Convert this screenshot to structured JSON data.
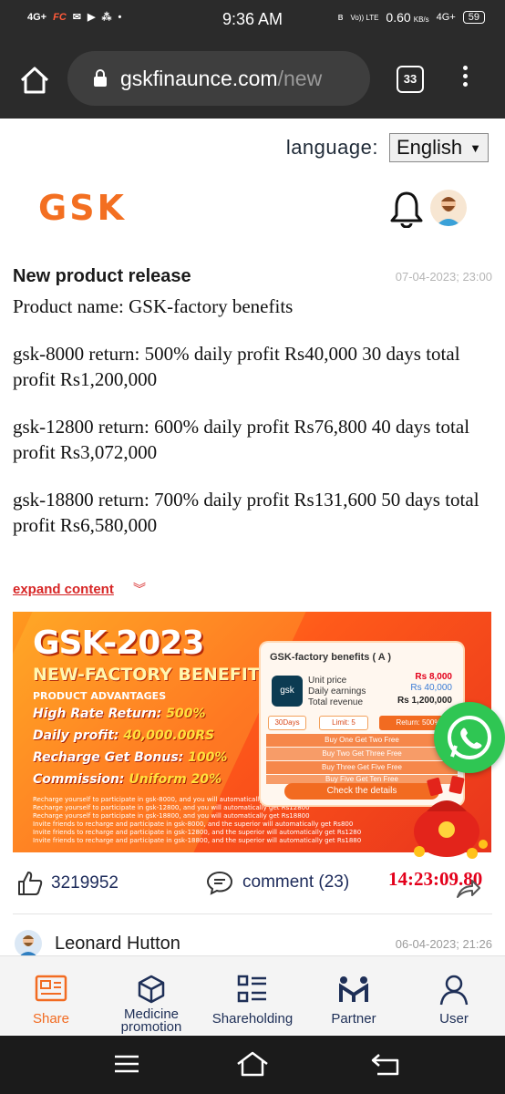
{
  "status_bar": {
    "left": [
      "4G+",
      "FC"
    ],
    "time": "9:36 AM",
    "network_speed": "0.60",
    "network_speed_unit": "KB/s",
    "volte": "Vo)) LTE",
    "signal": "4G+",
    "battery": "59"
  },
  "browser": {
    "url_host": "gskfinaunce.com",
    "url_path": "/new",
    "tab_count": "33"
  },
  "header": {
    "language_label": "language:",
    "language_value": "English",
    "logo_text": "GSK"
  },
  "post": {
    "title": "New product release",
    "date": "07-04-2023; 23:00",
    "paragraphs": [
      "Product name: GSK-factory benefits",
      "gsk-8000 return: 500% daily profit Rs40,000 30 days total profit Rs1,200,000",
      "gsk-12800 return: 600% daily profit Rs76,800 40 days total profit Rs3,072,000",
      "gsk-18800 return: 700% daily profit Rs131,600 50 days total profit Rs6,580,000"
    ],
    "expand_label": "expand content"
  },
  "banner": {
    "title": "GSK-2023",
    "subtitle": "NEW-FACTORY BENEFITS",
    "advantages_heading": "PRODUCT ADVANTAGES",
    "lines": [
      {
        "key": "High Rate Return:",
        "value": "500%"
      },
      {
        "key": "Daily profit:",
        "value": "40,000.00RS"
      },
      {
        "key": "Recharge Get Bonus:",
        "value": "100%"
      },
      {
        "key": "Commission:",
        "value": "Uniform 20%"
      }
    ],
    "fine_print": [
      "Recharge yourself to participate in gsk-8000, and you will automatically get Rs8000",
      "Recharge yourself to participate in gsk-12800, and you will automatically get Rs12800",
      "Recharge yourself to participate in gsk-18800, and you will automatically get Rs18800",
      "Invite friends to recharge and participate in gsk-8000, and the superior will automatically get Rs800",
      "Invite friends to recharge and participate in gsk-12800, and the superior will automatically get Rs1280",
      "Invite friends to recharge and participate in gsk-18800, and the superior will automatically get Rs1880"
    ],
    "card": {
      "title": "GSK-factory benefits ( A )",
      "badge": "gsk",
      "unit_price_label": "Unit price",
      "unit_price": "Rs 8,000",
      "daily_label": "Daily earnings",
      "daily": "Rs 40,000",
      "total_label": "Total revenue",
      "total": "Rs 1,200,000",
      "days": "30Days",
      "limit": "Limit: 5",
      "return": "Return: 500%",
      "buy_offers": [
        "Buy One Get Two Free",
        "Buy Two Get Three Free",
        "Buy Three Get Five Free",
        "Buy Five Get Ten Free"
      ],
      "cta": "Check the details"
    }
  },
  "timer": "14:23:09.80",
  "engagement": {
    "likes": "3219952",
    "comment_label": "comment (23)"
  },
  "next_post": {
    "author": "Leonard Hutton",
    "date": "06-04-2023; 21:26"
  },
  "bottom_nav": [
    {
      "label": "Share",
      "icon": "share-card-icon",
      "active": true
    },
    {
      "label": "Medicine promotion",
      "icon": "cube-icon",
      "active": false
    },
    {
      "label": "Shareholding",
      "icon": "list-grid-icon",
      "active": false
    },
    {
      "label": "Partner",
      "icon": "partner-icon",
      "active": false
    },
    {
      "label": "User",
      "icon": "user-icon",
      "active": false
    }
  ],
  "colors": {
    "brand_orange": "#f36f21",
    "accent_red": "#d72626",
    "timer_red": "#e3001b",
    "nav_text": "#1e2f57",
    "whatsapp_green": "#2fc653"
  }
}
